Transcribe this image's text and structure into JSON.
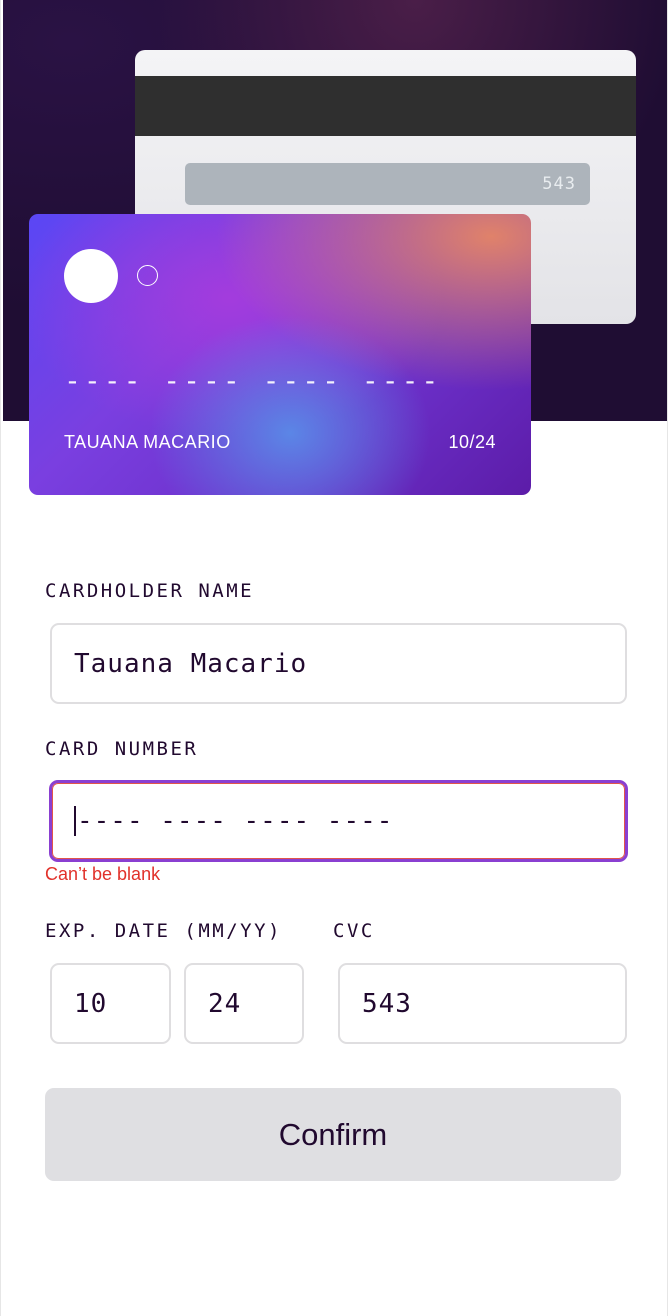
{
  "card_preview": {
    "back": {
      "cvc": "543"
    },
    "front": {
      "number_placeholder": "---- ---- ---- ----",
      "holder_name": "TAUANA MACARIO",
      "expiry": "10/24"
    }
  },
  "form": {
    "cardholder": {
      "label": "CARDHOLDER NAME",
      "value": "Tauana Macario"
    },
    "card_number": {
      "label": "CARD NUMBER",
      "placeholder": "---- ---- ---- ----",
      "value": "",
      "error": "Can’t be blank"
    },
    "expiry": {
      "label": "EXP. DATE (MM/YY)",
      "month": "10",
      "year": "24"
    },
    "cvc": {
      "label": "CVC",
      "value": "543"
    },
    "confirm_label": "Confirm"
  },
  "colors": {
    "hero_background": "#1f0d33",
    "text_dark": "#21092f",
    "error_red": "#e1312a",
    "input_border": "#dfdee0",
    "button_bg": "#dfdfe2"
  },
  "icons": [
    "card-logo-large-circle",
    "card-logo-small-circle"
  ]
}
